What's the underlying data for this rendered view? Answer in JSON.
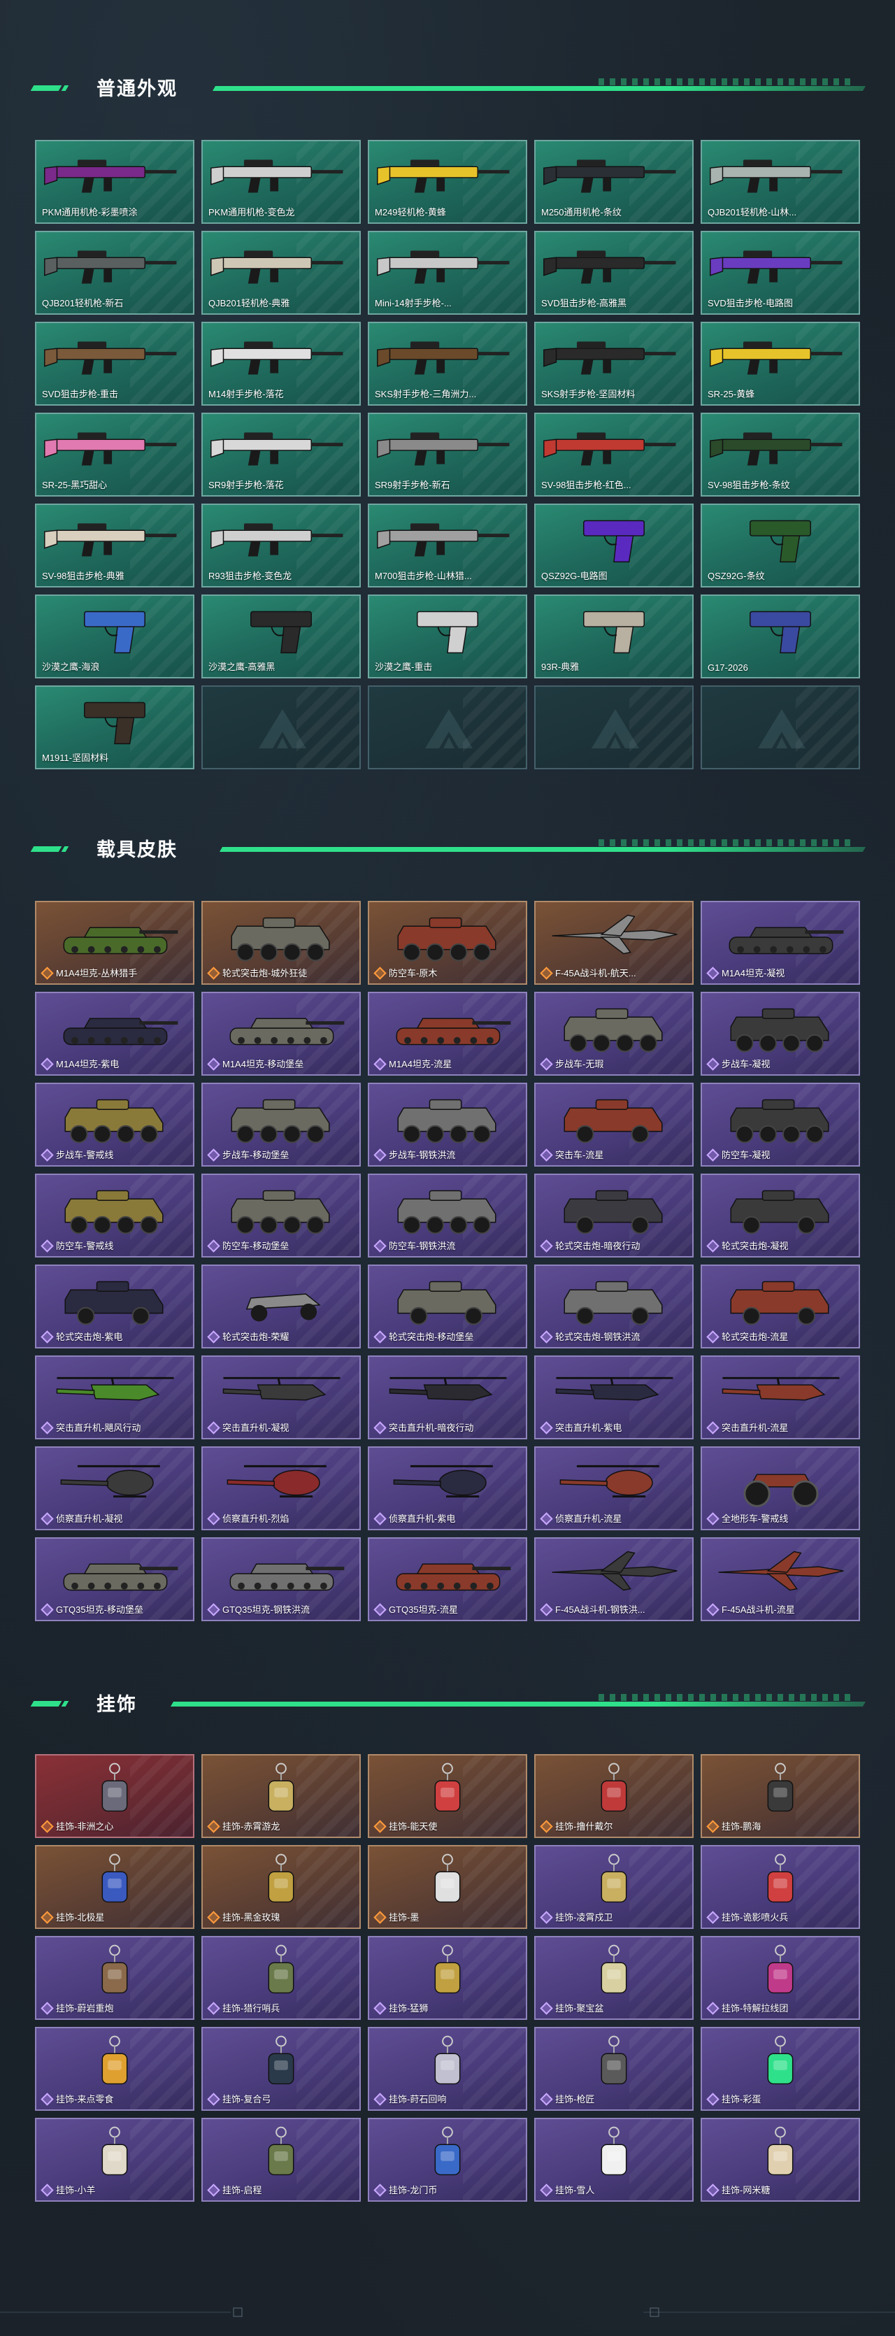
{
  "colors": {
    "accent": "#2fe08a",
    "weapon_card": "#1f6a5c",
    "orange_card": "#7a5236",
    "purple_card": "#4a3c7c",
    "red_card": "#8a3036"
  },
  "sections": {
    "weapons": {
      "title": "普通外观",
      "items": [
        {
          "label": "PKM通用机枪-彩墨喷涂",
          "color": "#7a2a8a"
        },
        {
          "label": "PKM通用机枪-变色龙",
          "color": "#cfcfcf"
        },
        {
          "label": "M249轻机枪-黄蜂",
          "color": "#e6c32a"
        },
        {
          "label": "M250通用机枪-条纹",
          "color": "#2a2f35"
        },
        {
          "label": "QJB201轻机枪-山林...",
          "color": "#a9b3b0"
        },
        {
          "label": "QJB201轻机枪-新石",
          "color": "#5a6060"
        },
        {
          "label": "QJB201轻机枪-典雅",
          "color": "#cfc7b5"
        },
        {
          "label": "Mini-14射手步枪-...",
          "color": "#c8c8c8"
        },
        {
          "label": "SVD狙击步枪-高雅黑",
          "color": "#2a2a2a"
        },
        {
          "label": "SVD狙击步枪-电路图",
          "color": "#6a3cc0"
        },
        {
          "label": "SVD狙击步枪-重击",
          "color": "#7a5a3a"
        },
        {
          "label": "M14射手步枪-落花",
          "color": "#e0e0e0"
        },
        {
          "label": "SKS射手步枪-三角洲力...",
          "color": "#6a4a2a"
        },
        {
          "label": "SKS射手步枪-坚固材料",
          "color": "#2a2a2a"
        },
        {
          "label": "SR-25-黄蜂",
          "color": "#e6c32a"
        },
        {
          "label": "SR-25-黑巧甜心",
          "color": "#e07ab0"
        },
        {
          "label": "SR9射手步枪-落花",
          "color": "#d8d8d8"
        },
        {
          "label": "SR9射手步枪-新石",
          "color": "#8a8a8a"
        },
        {
          "label": "SV-98狙击步枪-红色...",
          "color": "#c03a32"
        },
        {
          "label": "SV-98狙击步枪-条纹",
          "color": "#2a4a2a"
        },
        {
          "label": "SV-98狙击步枪-典雅",
          "color": "#d8cfbf"
        },
        {
          "label": "R93狙击步枪-变色龙",
          "color": "#cfcfcf"
        },
        {
          "label": "M700狙击步枪-山林猎...",
          "color": "#a0a0a0"
        },
        {
          "label": "QSZ92G-电路图",
          "color": "#5a2ac0"
        },
        {
          "label": "QSZ92G-条纹",
          "color": "#2a5a2a"
        },
        {
          "label": "沙漠之鹰-海浪",
          "color": "#3a6ac8"
        },
        {
          "label": "沙漠之鹰-高雅黑",
          "color": "#2a2a2a"
        },
        {
          "label": "沙漠之鹰-重击",
          "color": "#d0d0d0"
        },
        {
          "label": "93R-典雅",
          "color": "#b8b0a0"
        },
        {
          "label": "G17-2026",
          "color": "#3a4aa0"
        },
        {
          "label": "M1911-坚固材料",
          "color": "#3a3028"
        },
        {
          "label": "",
          "color": ""
        },
        {
          "label": "",
          "color": ""
        },
        {
          "label": "",
          "color": ""
        },
        {
          "label": "",
          "color": ""
        }
      ]
    },
    "vehicles": {
      "title": "载具皮肤",
      "items": [
        {
          "label": "M1A4坦克-丛林猎手",
          "tier": "orange",
          "kind": "tank",
          "color": "#4a6a2a"
        },
        {
          "label": "轮式突击炮-城外狂徒",
          "tier": "orange",
          "kind": "apc",
          "color": "#6a6a60"
        },
        {
          "label": "防空车-原木",
          "tier": "orange",
          "kind": "apc",
          "color": "#8a3a2a"
        },
        {
          "label": "F-45A战斗机-航天...",
          "tier": "orange",
          "kind": "jet",
          "color": "#8a8a8a"
        },
        {
          "label": "M1A4坦克-凝视",
          "tier": "purple",
          "kind": "tank",
          "color": "#3a3a3a"
        },
        {
          "label": "M1A4坦克-紫电",
          "tier": "purple",
          "kind": "tank",
          "color": "#2a2a40"
        },
        {
          "label": "M1A4坦克-移动堡垒",
          "tier": "purple",
          "kind": "tank",
          "color": "#6a6a60"
        },
        {
          "label": "M1A4坦克-流星",
          "tier": "purple",
          "kind": "tank",
          "color": "#8a3a2a"
        },
        {
          "label": "步战车-无瑕",
          "tier": "purple",
          "kind": "apc",
          "color": "#6a6a60"
        },
        {
          "label": "步战车-凝视",
          "tier": "purple",
          "kind": "apc",
          "color": "#3a3a3a"
        },
        {
          "label": "步战车-警戒线",
          "tier": "purple",
          "kind": "apc",
          "color": "#8a7a3a"
        },
        {
          "label": "步战车-移动堡垒",
          "tier": "purple",
          "kind": "apc",
          "color": "#6a6a60"
        },
        {
          "label": "步战车-钢铁洪流",
          "tier": "purple",
          "kind": "apc",
          "color": "#707070"
        },
        {
          "label": "突击车-流星",
          "tier": "purple",
          "kind": "truck",
          "color": "#8a3a2a"
        },
        {
          "label": "防空车-凝视",
          "tier": "purple",
          "kind": "apc",
          "color": "#3a3a3a"
        },
        {
          "label": "防空车-警戒线",
          "tier": "purple",
          "kind": "apc",
          "color": "#8a7a3a"
        },
        {
          "label": "防空车-移动堡垒",
          "tier": "purple",
          "kind": "apc",
          "color": "#6a6a60"
        },
        {
          "label": "防空车-钢铁洪流",
          "tier": "purple",
          "kind": "apc",
          "color": "#707070"
        },
        {
          "label": "轮式突击炮-暗夜行动",
          "tier": "purple",
          "kind": "truck",
          "color": "#3a3a40"
        },
        {
          "label": "轮式突击炮-凝视",
          "tier": "purple",
          "kind": "truck",
          "color": "#3a3a3a"
        },
        {
          "label": "轮式突击炮-紫电",
          "tier": "purple",
          "kind": "truck",
          "color": "#2a2a40"
        },
        {
          "label": "轮式突击炮-荣耀",
          "tier": "purple",
          "kind": "buggy",
          "color": "#8a8a8a"
        },
        {
          "label": "轮式突击炮-移动堡垒",
          "tier": "purple",
          "kind": "truck",
          "color": "#6a6a60"
        },
        {
          "label": "轮式突击炮-钢铁洪流",
          "tier": "purple",
          "kind": "truck",
          "color": "#707070"
        },
        {
          "label": "轮式突击炮-流星",
          "tier": "purple",
          "kind": "truck",
          "color": "#8a3a2a"
        },
        {
          "label": "突击直升机-飓风行动",
          "tier": "purple",
          "kind": "heli",
          "color": "#4a8a2a"
        },
        {
          "label": "突击直升机-凝视",
          "tier": "purple",
          "kind": "heli",
          "color": "#3a3a3a"
        },
        {
          "label": "突击直升机-暗夜行动",
          "tier": "purple",
          "kind": "heli",
          "color": "#2a2a30"
        },
        {
          "label": "突击直升机-紫电",
          "tier": "purple",
          "kind": "heli",
          "color": "#2a2a40"
        },
        {
          "label": "突击直升机-流星",
          "tier": "purple",
          "kind": "heli",
          "color": "#8a3a2a"
        },
        {
          "label": "侦察直升机-凝视",
          "tier": "purple",
          "kind": "scout",
          "color": "#3a3a3a"
        },
        {
          "label": "侦察直升机-烈焰",
          "tier": "purple",
          "kind": "scout",
          "color": "#8a2a2a"
        },
        {
          "label": "侦察直升机-紫电",
          "tier": "purple",
          "kind": "scout",
          "color": "#2a2a40"
        },
        {
          "label": "侦察直升机-流星",
          "tier": "purple",
          "kind": "scout",
          "color": "#8a3a2a"
        },
        {
          "label": "全地形车-警戒线",
          "tier": "purple",
          "kind": "atv",
          "color": "#8a3a2a"
        },
        {
          "label": "GTQ35坦克-移动堡垒",
          "tier": "purple",
          "kind": "tank",
          "color": "#6a6a60"
        },
        {
          "label": "GTQ35坦克-钢铁洪流",
          "tier": "purple",
          "kind": "tank",
          "color": "#707070"
        },
        {
          "label": "GTQ35坦克-流星",
          "tier": "purple",
          "kind": "tank",
          "color": "#8a3a2a"
        },
        {
          "label": "F-45A战斗机-钢铁洪...",
          "tier": "purple",
          "kind": "jet",
          "color": "#3a3a3a"
        },
        {
          "label": "F-45A战斗机-流星",
          "tier": "purple",
          "kind": "jet",
          "color": "#8a3a2a"
        }
      ]
    },
    "charms": {
      "title": "挂饰",
      "items": [
        {
          "label": "挂饰-非洲之心",
          "tier": "red",
          "color": "#6a6a7a"
        },
        {
          "label": "挂饰-赤霄游龙",
          "tier": "orange",
          "color": "#c8b060"
        },
        {
          "label": "挂饰-能天使",
          "tier": "orange",
          "color": "#d04040"
        },
        {
          "label": "挂饰-撸什戴尔",
          "tier": "orange",
          "color": "#c03a3a"
        },
        {
          "label": "挂饰-鹏海",
          "tier": "orange",
          "color": "#3a3a3a"
        },
        {
          "label": "挂饰-北极星",
          "tier": "orange",
          "color": "#3a5ac0"
        },
        {
          "label": "挂饰-黑金玫瑰",
          "tier": "orange",
          "color": "#c0a040"
        },
        {
          "label": "挂饰-墨",
          "tier": "orange",
          "color": "#e0e0e0"
        },
        {
          "label": "挂饰-凌霄戍卫",
          "tier": "purple",
          "color": "#c8b060"
        },
        {
          "label": "挂饰-诡影喷火兵",
          "tier": "purple",
          "color": "#d04040"
        },
        {
          "label": "挂饰-蔚岩重炮",
          "tier": "purple",
          "color": "#8a6a4a"
        },
        {
          "label": "挂饰-猎行哨兵",
          "tier": "purple",
          "color": "#6a7a4a"
        },
        {
          "label": "挂饰-猛狮",
          "tier": "purple",
          "color": "#c0a040"
        },
        {
          "label": "挂饰-聚宝盆",
          "tier": "purple",
          "color": "#d8d0a0"
        },
        {
          "label": "挂饰-特解拉线团",
          "tier": "purple",
          "color": "#c03a8a"
        },
        {
          "label": "挂饰-来点零食",
          "tier": "purple",
          "color": "#e0a030"
        },
        {
          "label": "挂饰-复合弓",
          "tier": "purple",
          "color": "#2a3a4a"
        },
        {
          "label": "挂饰-莳石回响",
          "tier": "purple",
          "color": "#c0c0d0"
        },
        {
          "label": "挂饰-枪匠",
          "tier": "purple",
          "color": "#5a5a5a"
        },
        {
          "label": "挂饰-彩蛋",
          "tier": "purple",
          "color": "#2fe08a"
        },
        {
          "label": "挂饰-小羊",
          "tier": "purple",
          "color": "#e0d8c8"
        },
        {
          "label": "挂饰-启程",
          "tier": "purple",
          "color": "#6a7a4a"
        },
        {
          "label": "挂饰-龙门币",
          "tier": "purple",
          "color": "#3a6ac8"
        },
        {
          "label": "挂饰-雪人",
          "tier": "purple",
          "color": "#f0f0f0"
        },
        {
          "label": "挂饰-网米糖",
          "tier": "purple",
          "color": "#e0d0b0"
        }
      ]
    }
  }
}
